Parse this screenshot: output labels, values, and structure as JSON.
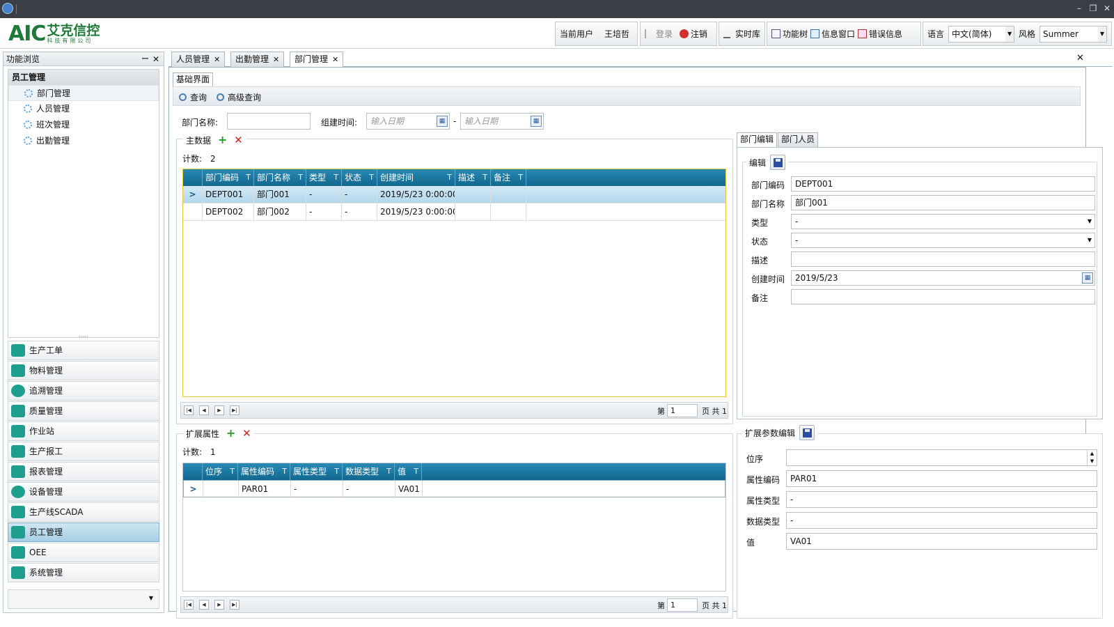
{
  "window": {
    "minimize": "–",
    "restore": "❐",
    "close": "✕"
  },
  "header": {
    "logo_text": "AIC",
    "logo_cn": "艾克信控",
    "logo_sub": "科技有限公司",
    "current_user_label": "当前用户",
    "current_user": "王培哲",
    "login": "登录",
    "logout": "注销",
    "realtime_db": "实时库",
    "function_tree": "功能树",
    "info_window": "信息窗口",
    "error_info": "错误信息",
    "language_label": "语言",
    "language_value": "中文(简体)",
    "style_label": "风格",
    "style_value": "Summer"
  },
  "left_panel": {
    "title": "功能浏览",
    "pin": "ꟷ",
    "close": "✕",
    "tree_root": "员工管理",
    "tree_items": [
      "部门管理",
      "人员管理",
      "班次管理",
      "出勤管理"
    ],
    "splitter": "·····",
    "modules": [
      "生产工单",
      "物料管理",
      "追溯管理",
      "质量管理",
      "作业站",
      "生产报工",
      "报表管理",
      "设备管理",
      "生产线SCADA",
      "员工管理",
      "OEE",
      "系统管理"
    ],
    "active_module": "员工管理",
    "bottom_arrow": "▼"
  },
  "tabs": [
    {
      "label": "人员管理",
      "close": "✕"
    },
    {
      "label": "出勤管理",
      "close": "✕"
    },
    {
      "label": "部门管理",
      "close": "✕"
    }
  ],
  "tab_close_all": "✕",
  "content": {
    "inner_tab": "基础界面",
    "query": "查询",
    "advanced_query": "高级查询",
    "dept_name_label": "部门名称:",
    "dept_name_value": "",
    "build_time_label": "组建时间:",
    "date_placeholder_1": "输入日期",
    "date_placeholder_2": "输入日期",
    "date_dash": "-",
    "main_data": {
      "title": "主数据",
      "count_label": "计数:",
      "count": "2",
      "columns": [
        "部门编码",
        "部门名称",
        "类型",
        "状态",
        "创建时间",
        "描述",
        "备注"
      ],
      "rows": [
        [
          "DEPT001",
          "部门001",
          "-",
          "-",
          "2019/5/23 0:00:00",
          "",
          ""
        ],
        [
          "DEPT002",
          "部门002",
          "-",
          "-",
          "2019/5/23 0:00:00",
          "",
          ""
        ]
      ],
      "selected_indicator": ">",
      "filter_icon": "T",
      "pager": {
        "first": "|◀",
        "prev": "◀",
        "next": "▶",
        "last": "▶|",
        "page_label": "第",
        "page": "1",
        "total": "页 共 1"
      }
    },
    "ext_attr": {
      "title": "扩展属性",
      "count_label": "计数:",
      "count": "1",
      "columns": [
        "位序",
        "属性编码",
        "属性类型",
        "数据类型",
        "值"
      ],
      "rows": [
        [
          "",
          "PAR01",
          "-",
          "-",
          "VA01"
        ]
      ],
      "pager": {
        "first": "|◀",
        "prev": "◀",
        "next": "▶",
        "last": "▶|",
        "page_label": "第",
        "page": "1",
        "total": "页 共 1"
      }
    },
    "right_tabs": [
      "部门编辑",
      "部门人员"
    ],
    "edit": {
      "title": "编辑",
      "fields": [
        {
          "label": "部门编码",
          "value": "DEPT001"
        },
        {
          "label": "部门名称",
          "value": "部门001"
        },
        {
          "label": "类型",
          "value": "-"
        },
        {
          "label": "状态",
          "value": "-"
        },
        {
          "label": "描述",
          "value": ""
        },
        {
          "label": "创建时间",
          "value": "2019/5/23"
        },
        {
          "label": "备注",
          "value": ""
        }
      ],
      "dropdown_arrow": "▼"
    },
    "ext_edit": {
      "title": "扩展参数编辑",
      "fields": [
        {
          "label": "位序",
          "value": ""
        },
        {
          "label": "属性编码",
          "value": "PAR01"
        },
        {
          "label": "属性类型",
          "value": "-"
        },
        {
          "label": "数据类型",
          "value": "-"
        },
        {
          "label": "值",
          "value": "VA01"
        }
      ],
      "spin_up": "▲",
      "spin_down": "▼"
    }
  }
}
